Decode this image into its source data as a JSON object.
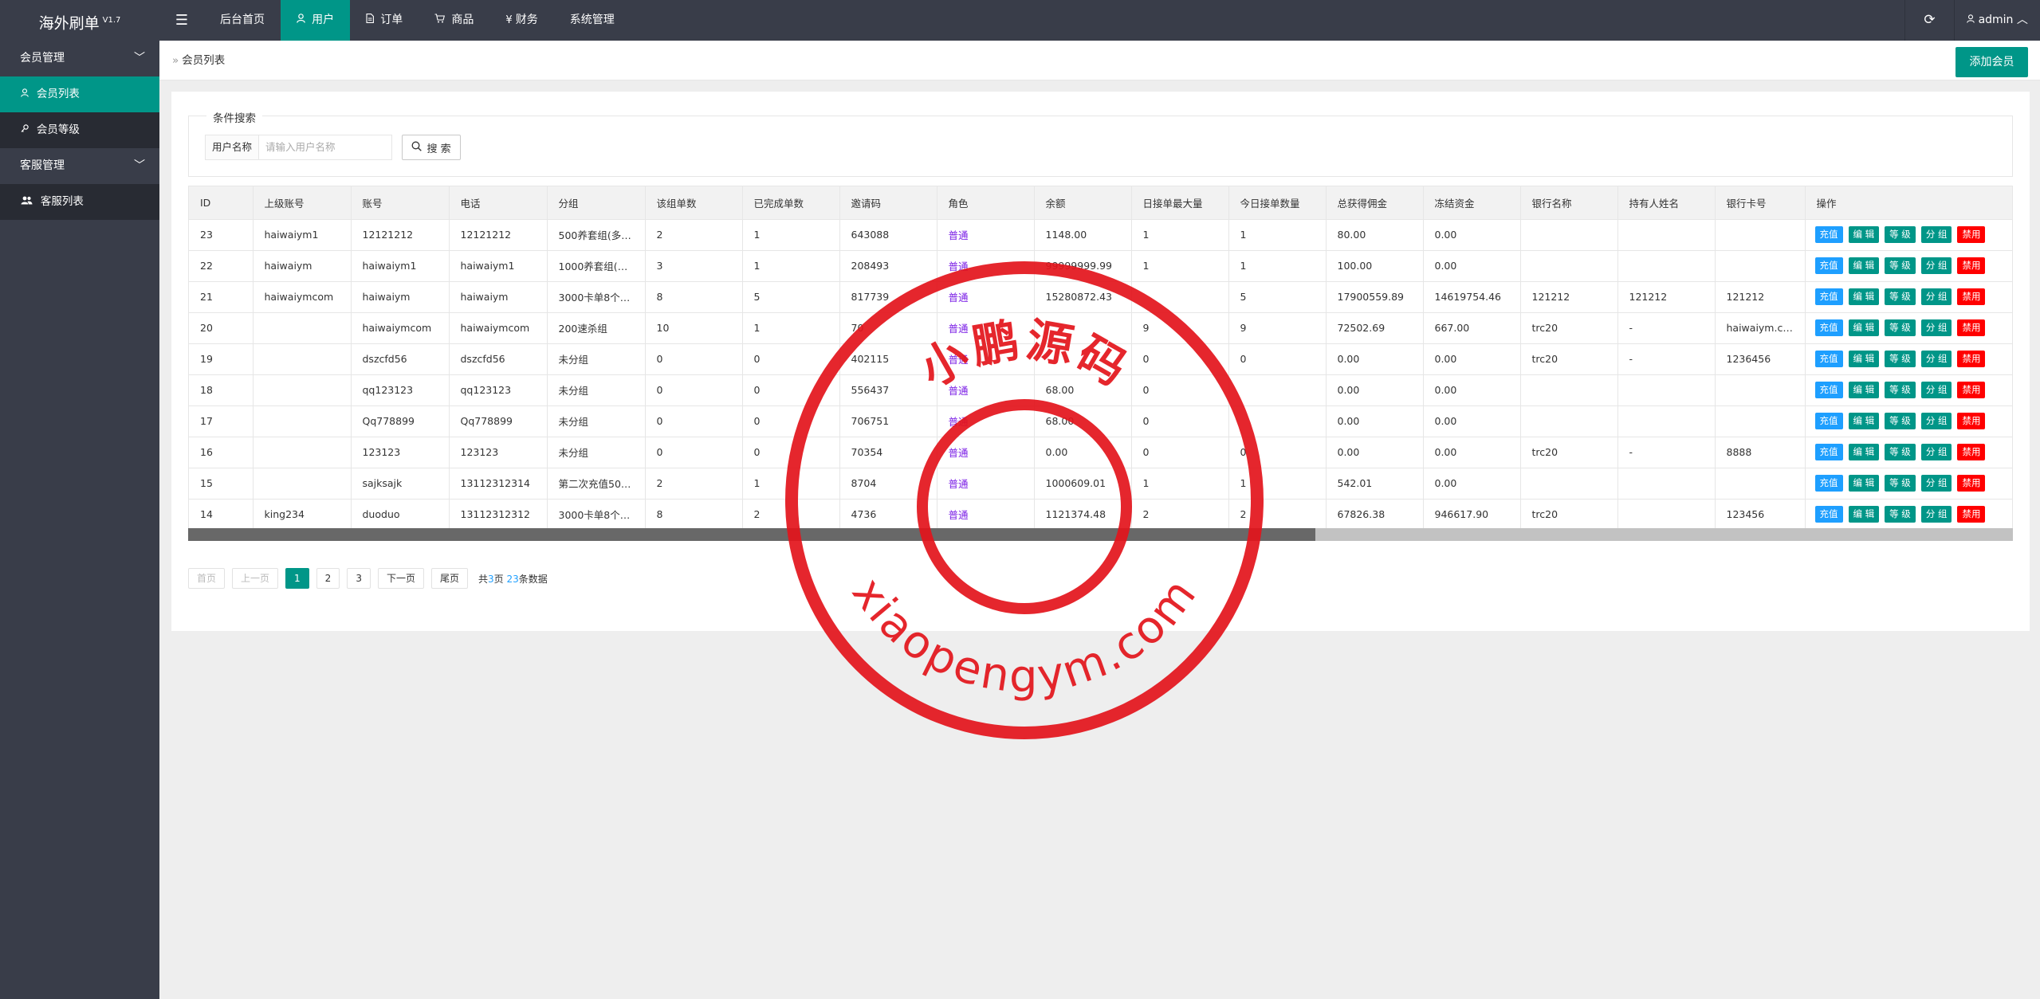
{
  "app": {
    "title": "海外刷单",
    "version": "V1.7"
  },
  "topnav": [
    {
      "label": "后台首页",
      "icon": "",
      "active": false
    },
    {
      "label": "用户",
      "icon": "user-icon",
      "active": true
    },
    {
      "label": "订单",
      "icon": "file-icon",
      "active": false
    },
    {
      "label": "商品",
      "icon": "cart-icon",
      "active": false
    },
    {
      "label": "财务",
      "icon": "yen-icon",
      "active": false
    },
    {
      "label": "系统管理",
      "icon": "",
      "active": false
    }
  ],
  "topright": {
    "user": "admin"
  },
  "sidebar": {
    "groups": [
      {
        "label": "会员管理",
        "items": [
          {
            "label": "会员列表",
            "icon": "user-icon",
            "active": true
          },
          {
            "label": "会员等级",
            "icon": "key-icon",
            "active": false
          }
        ]
      },
      {
        "label": "客服管理",
        "items": [
          {
            "label": "客服列表",
            "icon": "users-icon",
            "active": false
          }
        ]
      }
    ]
  },
  "breadcrumb": {
    "current": "会员列表"
  },
  "add_button": "添加会员",
  "filter": {
    "legend": "条件搜索",
    "label": "用户名称",
    "placeholder": "请输入用户名称",
    "search_label": "搜 索"
  },
  "table": {
    "columns": [
      "ID",
      "上级账号",
      "账号",
      "电话",
      "分组",
      "该组单数",
      "已完成单数",
      "邀请码",
      "角色",
      "余额",
      "日接单最大量",
      "今日接单数量",
      "总获得佣金",
      "冻结资金",
      "银行名称",
      "持有人姓名",
      "银行卡号",
      "操作"
    ],
    "rows": [
      [
        "23",
        "haiwaiym1",
        "12121212",
        "12121212",
        "500养套组(多…",
        "2",
        "1",
        "643088",
        "普通",
        "1148.00",
        "1",
        "1",
        "80.00",
        "0.00",
        "",
        "",
        ""
      ],
      [
        "22",
        "haiwaiym",
        "haiwaiym1",
        "haiwaiym1",
        "1000养套组(多…",
        "3",
        "1",
        "208493",
        "普通",
        "99999999.99",
        "1",
        "1",
        "100.00",
        "0.00",
        "",
        "",
        ""
      ],
      [
        "21",
        "haiwaiymcom",
        "haiwaiym",
        "haiwaiym",
        "3000卡单8个…",
        "8",
        "5",
        "817739",
        "普通",
        "15280872.43",
        "",
        "5",
        "17900559.89",
        "14619754.46",
        "121212",
        "121212",
        "121212"
      ],
      [
        "20",
        "",
        "haiwaiymcom",
        "haiwaiymcom",
        "200速杀组",
        "10",
        "1",
        "70",
        "普通",
        "",
        "9",
        "9",
        "72502.69",
        "667.00",
        "trc20",
        "-",
        "haiwaiym.com"
      ],
      [
        "19",
        "",
        "dszcfd56",
        "dszcfd56",
        "未分组",
        "0",
        "0",
        "402115",
        "普通",
        "",
        "0",
        "0",
        "0.00",
        "0.00",
        "trc20",
        "-",
        "1236456"
      ],
      [
        "18",
        "",
        "qq123123",
        "qq123123",
        "未分组",
        "0",
        "0",
        "556437",
        "普通",
        "68.00",
        "0",
        "",
        "0.00",
        "0.00",
        "",
        "",
        ""
      ],
      [
        "17",
        "",
        "Qq778899",
        "Qq778899",
        "未分组",
        "0",
        "0",
        "706751",
        "普通",
        "68.00",
        "0",
        "",
        "0.00",
        "0.00",
        "",
        "",
        ""
      ],
      [
        "16",
        "",
        "123123",
        "123123",
        "未分组",
        "0",
        "0",
        "70354",
        "普通",
        "0.00",
        "0",
        "0",
        "0.00",
        "0.00",
        "trc20",
        "-",
        "8888"
      ],
      [
        "15",
        "",
        "sajksajk",
        "13112312314",
        "第二次充值50…",
        "2",
        "1",
        "8704",
        "普通",
        "1000609.01",
        "1",
        "1",
        "542.01",
        "0.00",
        "",
        "",
        ""
      ],
      [
        "14",
        "king234",
        "duoduo",
        "13112312312",
        "3000卡单8个…",
        "8",
        "2",
        "4736",
        "普通",
        "1121374.48",
        "2",
        "2",
        "67826.38",
        "946617.90",
        "trc20",
        "",
        "123456"
      ]
    ],
    "ops": [
      {
        "label": "充值",
        "color": "#1e9fff"
      },
      {
        "label": "编 辑",
        "color": "#009688"
      },
      {
        "label": "等 级",
        "color": "#009688"
      },
      {
        "label": "分 组",
        "color": "#009688"
      },
      {
        "label": "禁用",
        "color": "#ff0000"
      }
    ]
  },
  "pagination": {
    "first": "首页",
    "prev": "上一页",
    "pages": [
      "1",
      "2",
      "3"
    ],
    "current": "1",
    "next": "下一页",
    "last": "尾页",
    "info_prefix": "共",
    "total_pages": "3",
    "info_mid": "页 ",
    "total_count": "23",
    "info_suffix": "条数据"
  },
  "watermark": {
    "top_text": "小鹏源码",
    "bottom_text": "xiaopengym.com",
    "color": "#e3141b"
  }
}
